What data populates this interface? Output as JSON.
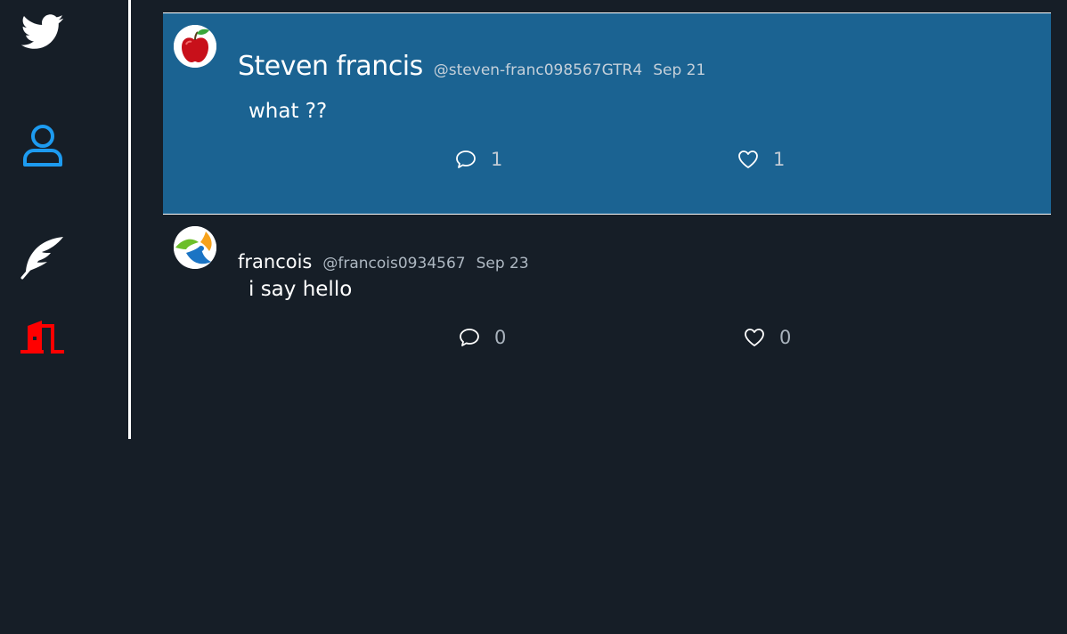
{
  "colors": {
    "background": "#161e27",
    "highlight": "#1b6392",
    "accent_blue": "#1d9bf0",
    "logout_red": "#ff0000"
  },
  "sidebar": {
    "items": [
      {
        "icon": "twitter-bird-icon"
      },
      {
        "icon": "user-icon"
      },
      {
        "icon": "feather-quill-icon"
      },
      {
        "icon": "logout-door-icon"
      }
    ]
  },
  "tweets": [
    {
      "display_name": "Steven francis",
      "handle": "@steven-franc098567GTR4",
      "date": "Sep 21",
      "text": "what ??",
      "replies": "1",
      "likes": "1",
      "avatar_icon": "red-apple-icon"
    },
    {
      "display_name": "francois",
      "handle": "@francois0934567",
      "date": "Sep 23",
      "text": "i say hello",
      "replies": "0",
      "likes": "0",
      "avatar_icon": "logo-icon"
    }
  ]
}
